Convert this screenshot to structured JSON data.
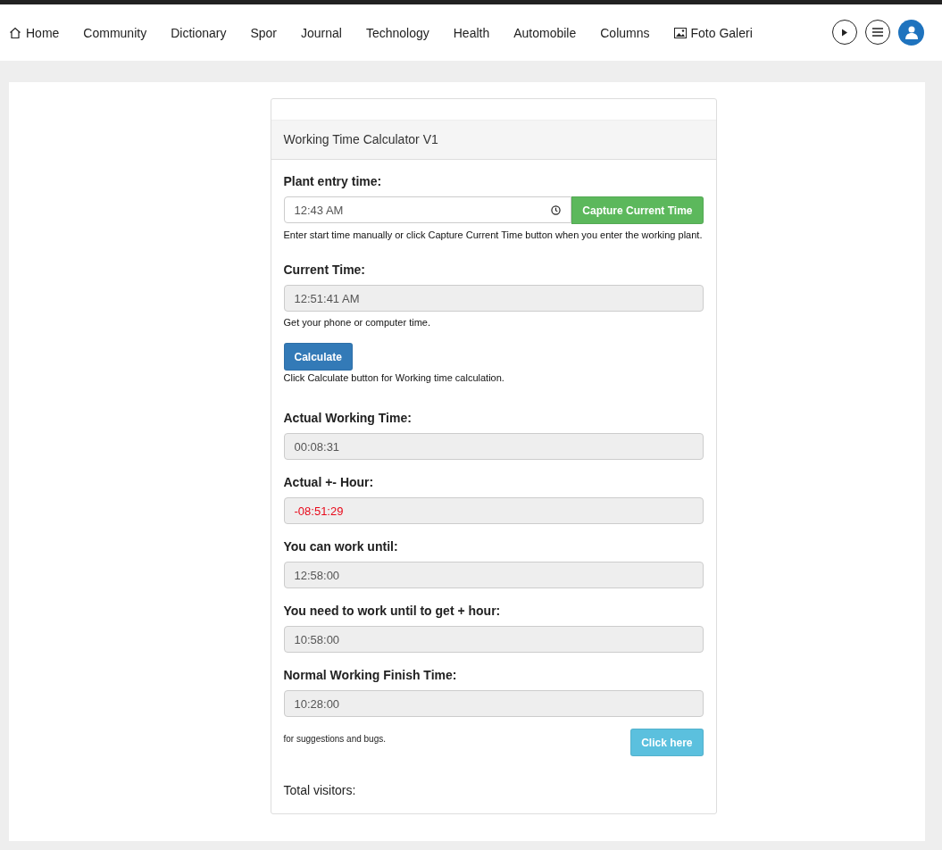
{
  "nav": [
    {
      "label": "Home",
      "kind": "house"
    },
    {
      "label": "Community",
      "kind": "plain"
    },
    {
      "label": "Dictionary",
      "kind": "plain"
    },
    {
      "label": "Spor",
      "kind": "plain"
    },
    {
      "label": "Journal",
      "kind": "plain"
    },
    {
      "label": "Technology",
      "kind": "plain"
    },
    {
      "label": "Health",
      "kind": "plain"
    },
    {
      "label": "Automobile",
      "kind": "plain"
    },
    {
      "label": "Columns",
      "kind": "plain"
    },
    {
      "label": "Foto Galeri",
      "kind": "picture"
    }
  ],
  "card": {
    "title": "Working Time Calculator V1",
    "entry": {
      "label": "Plant entry time:",
      "value": "12:43 AM",
      "button": "Capture Current Time",
      "help": "Enter start time manually or click Capture Current Time button when you enter the working plant."
    },
    "current": {
      "label": "Current Time:",
      "value": "12:51:41 AM",
      "help": "Get your phone or computer time."
    },
    "calculate": {
      "button": "Calculate",
      "help": "Click Calculate button for Working time calculation."
    },
    "results": [
      {
        "label": "Actual Working Time:",
        "value": "00:08:31",
        "kind": "normal"
      },
      {
        "label": "Actual +- Hour:",
        "value": "-08:51:29",
        "kind": "negative"
      },
      {
        "label": "You can work until:",
        "value": "12:58:00",
        "kind": "normal"
      },
      {
        "label": "You need to work until to get + hour:",
        "value": "10:58:00",
        "kind": "normal"
      },
      {
        "label": "Normal Working Finish Time:",
        "value": "10:28:00",
        "kind": "normal"
      }
    ],
    "feedback": {
      "text": "for suggestions and bugs.",
      "button": "Click here"
    },
    "visitors": "Total visitors:"
  }
}
